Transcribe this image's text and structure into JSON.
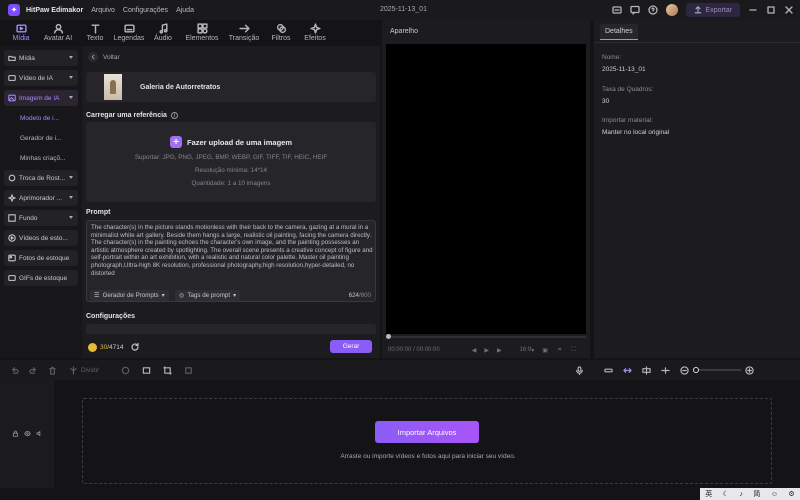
{
  "app": {
    "name": "HitPaw Edimakor",
    "menus": [
      "Arquivo",
      "Configurações",
      "Ajuda"
    ],
    "doc_title": "2025-11-13_01",
    "export_label": "Exportar"
  },
  "toptabs": [
    {
      "label": "Mídia",
      "icon": "media-icon"
    },
    {
      "label": "Avatar AI",
      "icon": "avatar-icon"
    },
    {
      "label": "Texto",
      "icon": "text-icon"
    },
    {
      "label": "Legendas",
      "icon": "subtitle-icon"
    },
    {
      "label": "Áudio",
      "icon": "audio-icon"
    },
    {
      "label": "Elementos",
      "icon": "elements-icon"
    },
    {
      "label": "Transição",
      "icon": "transition-icon"
    },
    {
      "label": "Filtros",
      "icon": "filter-icon"
    },
    {
      "label": "Efeitos",
      "icon": "effects-icon"
    }
  ],
  "leftnav": {
    "items": [
      "Mídia",
      "Vídeo de IA",
      "Imagem de IA",
      "Troca de Rost...",
      "Aprimorador ...",
      "Fundo",
      "Vídeos de esto...",
      "Fotos de estoque",
      "GIFs de estoque"
    ],
    "sub": [
      "Modelo de i...",
      "Gerador de i...",
      "Minhas criaçõ..."
    ]
  },
  "panel": {
    "back_label": "Voltar",
    "gallery_name": "Galeria de Autorretratos",
    "ref_title": "Carregar uma referência",
    "upload_label": "Fazer upload de uma imagem",
    "upload_support": "Suportar: JPG, PNG, JPEG, BMP, WEBP, GIF, TIFF, TIF, HEIC, HEIF",
    "upload_resolution": "Resolução mínima: 14*14",
    "upload_quantity": "Quantidade: 1 a 10 imagens",
    "prompt_title": "Prompt",
    "prompt_text": "The character(s) in the picture stands motionless with their back to the camera, gazing at a mural in a minimalist white art gallery. Beside them hangs a large, realistic oil painting, facing the camera directly. The character(s) in the painting echoes the character's own image, and the painting possesses an artistic atmosphere created by spotlighting. The overall scene presents a creative concept of figure and self-portrait within an art exhibition, with a realistic and natural color palette. Master oil painting photograph,Ultra-high 8K resolution, professional photography,high resolution,hyper-detailed, no distorted",
    "prompt_gen_label": "Gerador de Prompts",
    "prompt_tags_label": "Tags de prompt",
    "char_count": "624",
    "char_max": "/800",
    "config_title": "Configurações",
    "credits_used": "30",
    "credits_total": "/4714",
    "generate_label": "Gerar"
  },
  "player": {
    "title": "Aparelho",
    "time": "00:00:00 / 00:00:00",
    "ratio": "16:9"
  },
  "details": {
    "tab": "Detalhes",
    "name_label": "Nome:",
    "name_value": "2025-11-13_01",
    "fps_label": "Taxa de Quadros:",
    "fps_value": "30",
    "import_label": "Importar material:",
    "import_value": "Manter no local original"
  },
  "timeline": {
    "split_label": "Dividir",
    "import_label": "Importar Arquivos",
    "hint": "Arraste ou importe vídeos e fotos aqui para iniciar seu vídeo."
  },
  "taskbar": [
    "英",
    "☾",
    "♪",
    "简",
    "☺",
    "⚙"
  ]
}
